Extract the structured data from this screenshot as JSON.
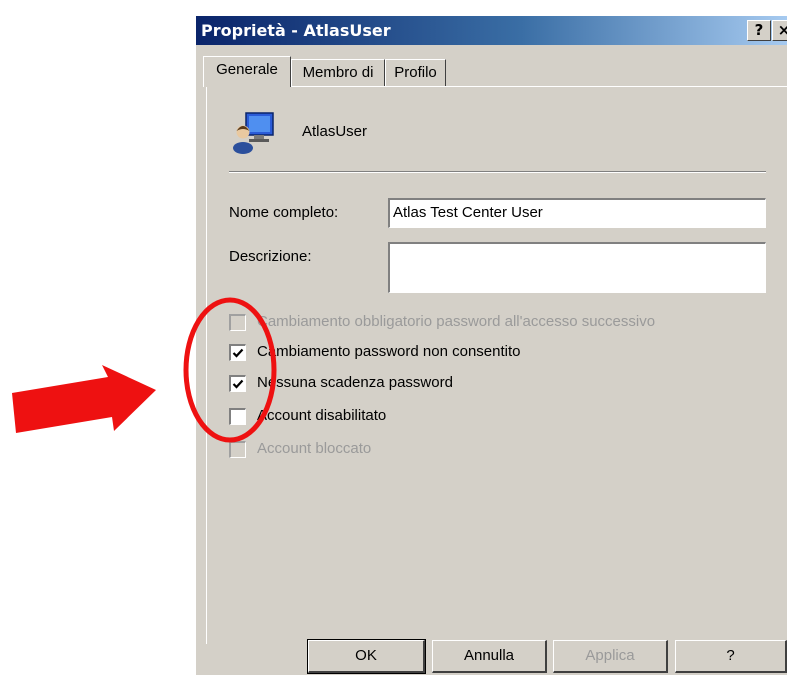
{
  "window": {
    "title": "Proprietà - AtlasUser",
    "help_label": "?",
    "close_label": "×"
  },
  "tabs": [
    {
      "label": "Generale",
      "active": true
    },
    {
      "label": "Membro di",
      "active": false
    },
    {
      "label": "Profilo",
      "active": false
    }
  ],
  "user": {
    "name": "AtlasUser",
    "icon": "user-computer-icon"
  },
  "form": {
    "full_name_label": "Nome completo:",
    "full_name_value": "Atlas Test Center User",
    "description_label": "Descrizione:",
    "description_value": ""
  },
  "checkboxes": [
    {
      "label": "Cambiamento obbligatorio password all'accesso successivo",
      "checked": false,
      "enabled": false
    },
    {
      "label": "Cambiamento password non consentito",
      "checked": true,
      "enabled": true
    },
    {
      "label": "Nessuna scadenza password",
      "checked": true,
      "enabled": true
    },
    {
      "label": "Account disabilitato",
      "checked": false,
      "enabled": true
    },
    {
      "label": "Account bloccato",
      "checked": false,
      "enabled": false
    }
  ],
  "buttons": {
    "ok": "OK",
    "cancel": "Annulla",
    "apply": "Applica",
    "help": "?"
  },
  "annotations": {
    "arrow_color": "#ee1111",
    "circle_color": "#ee1111"
  }
}
